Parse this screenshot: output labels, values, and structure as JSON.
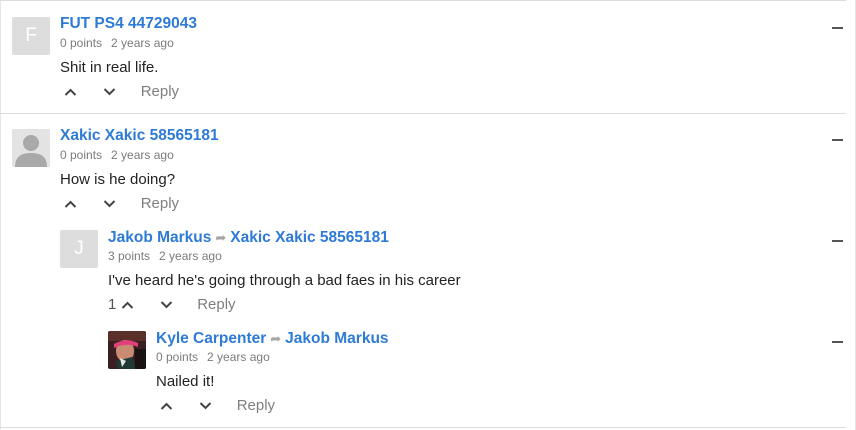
{
  "comments": [
    {
      "avatar_letter": "F",
      "author": "FUT PS4 44729043",
      "points": "0 points",
      "time": "2 years ago",
      "text": "Shit in real life.",
      "reply_label": "Reply",
      "collapse_icon": "minus-icon"
    },
    {
      "avatar_type": "default-user",
      "author": "Xakic Xakic 58565181",
      "points": "0 points",
      "time": "2 years ago",
      "text": "How is he doing?",
      "reply_label": "Reply",
      "collapse_icon": "minus-icon"
    },
    {
      "avatar_letter": "J",
      "author": "Jakob Markus",
      "reply_to": "Xakic Xakic 58565181",
      "points": "3 points",
      "time": "2 years ago",
      "text": "I've heard he's going through a bad faes in his career",
      "upvotes": "1",
      "reply_label": "Reply",
      "collapse_icon": "minus-icon"
    },
    {
      "avatar_type": "photo",
      "author": "Kyle Carpenter",
      "reply_to": "Jakob Markus",
      "points": "0 points",
      "time": "2 years ago",
      "text": "Nailed it!",
      "reply_label": "Reply",
      "collapse_icon": "minus-icon"
    }
  ],
  "colors": {
    "author_link": "#2e7bd6",
    "meta_text": "#7b7b7b",
    "divider": "#dcdcdc"
  }
}
